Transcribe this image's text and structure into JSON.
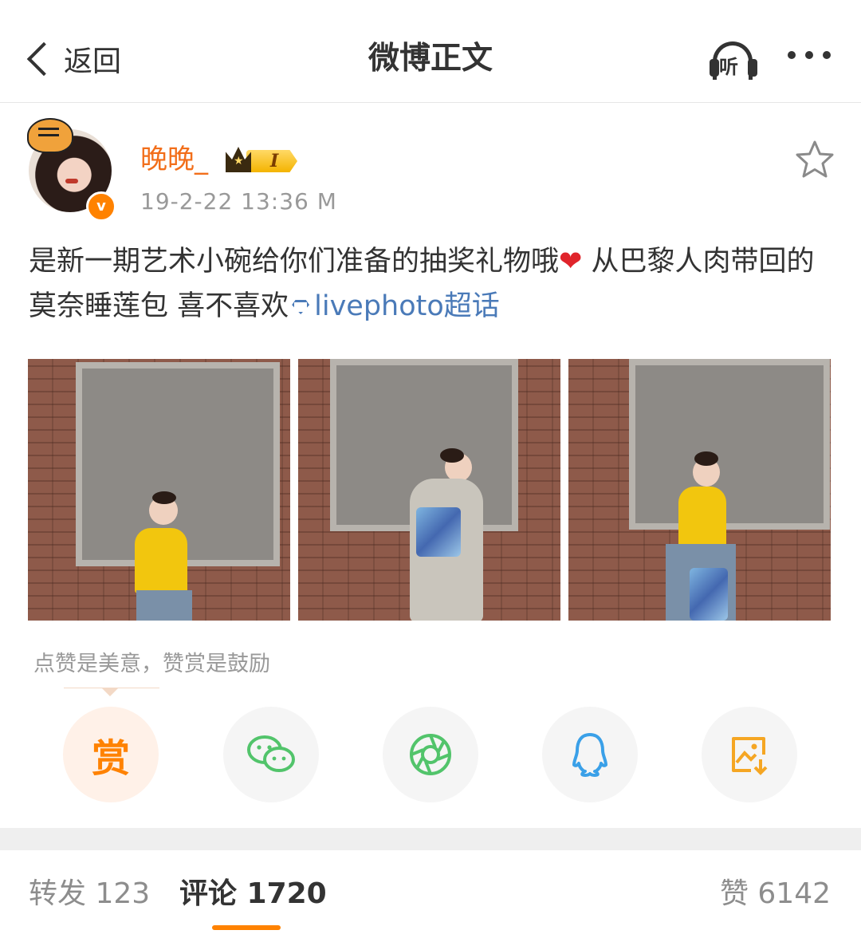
{
  "nav": {
    "back_label": "返回",
    "title": "微博正文",
    "listen_label": "听"
  },
  "post": {
    "author": "晚晚_",
    "member_badge": "I",
    "verified_mark": "v",
    "timestamp": "19-2-22 13:36  M",
    "text_part1": "是新一期艺术小碗给你们准备的抽奖礼物哦",
    "heart": "❤",
    "text_part2": " 从巴黎人肉带回的莫奈睡莲包 喜不喜欢",
    "topic": "livephoto超话"
  },
  "reward": {
    "tip": "点赞是美意，赞赏是鼓励",
    "reward_label": "赏"
  },
  "share_targets": [
    "reward-icon",
    "wechat-icon",
    "moments-icon",
    "qq-icon",
    "save-image-icon"
  ],
  "tabs": {
    "repost": "转发 123",
    "comments": "评论 1720",
    "likes": "赞 6142"
  },
  "colors": {
    "accent": "#ff8200",
    "username": "#f26e1a",
    "link": "#4a7ab8",
    "wechat": "#52c46b",
    "qq": "#3aa0e8"
  }
}
